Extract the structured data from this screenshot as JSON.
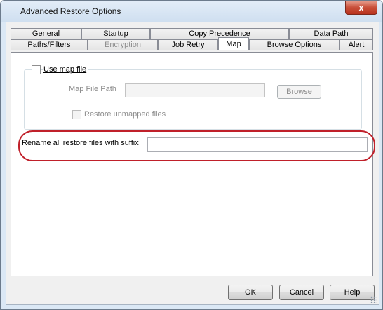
{
  "window": {
    "title": "Advanced Restore Options",
    "close_glyph": "x"
  },
  "tabs": {
    "row1": [
      "General",
      "Startup",
      "Copy Precedence",
      "Data Path"
    ],
    "row2": [
      "Paths/Filters",
      "Encryption",
      "Job Retry",
      "Map",
      "Browse Options",
      "Alert"
    ],
    "active": "Map",
    "disabled": [
      "Encryption"
    ]
  },
  "map": {
    "use_map_file_label": "Use map file",
    "use_map_file_checked": false,
    "map_file_path_label": "Map File Path",
    "map_file_path_value": "",
    "browse_label": "Browse",
    "restore_unmapped_label": "Restore unmapped files",
    "restore_unmapped_checked": false,
    "rename_suffix_label": "Rename all restore files with suffix",
    "rename_suffix_value": ""
  },
  "buttons": {
    "ok": "OK",
    "cancel": "Cancel",
    "help": "Help"
  },
  "colors": {
    "highlight_ellipse": "#c0202a",
    "close_button": "#c9503a"
  }
}
